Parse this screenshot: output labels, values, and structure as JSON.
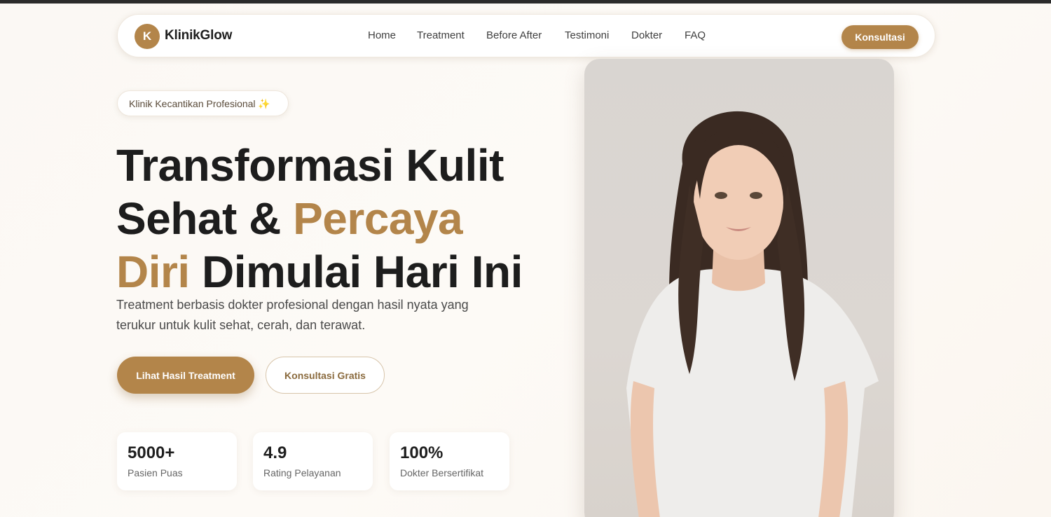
{
  "brand": {
    "initial": "K",
    "name": "KlinikGlow",
    "accent_color": "#b3854a"
  },
  "nav": {
    "items": [
      "Home",
      "Treatment",
      "Before After",
      "Testimoni",
      "Dokter",
      "FAQ"
    ],
    "cta": "Konsultasi"
  },
  "hero": {
    "badge": "Klinik Kecantikan Profesional ✨",
    "title_part1": "Transformasi Kulit Sehat & ",
    "title_accent": "Percaya Diri",
    "title_part2": " Dimulai Hari Ini",
    "description": "Treatment berbasis dokter profesional dengan hasil nyata yang terukur untuk kulit sehat, cerah, dan terawat.",
    "primary_button": "Lihat Hasil Treatment",
    "secondary_button": "Konsultasi Gratis"
  },
  "stats": [
    {
      "value": "5000+",
      "label": "Pasien Puas"
    },
    {
      "value": "4.9",
      "label": "Rating Pelayanan"
    },
    {
      "value": "100%",
      "label": "Dokter Bersertifikat"
    }
  ],
  "image": {
    "subject": "woman-portrait"
  }
}
